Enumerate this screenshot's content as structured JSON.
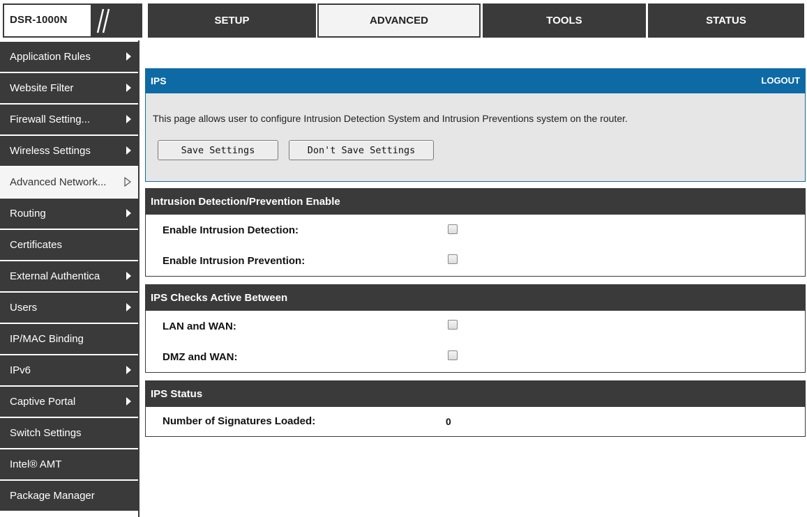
{
  "header": {
    "logo_text": "DSR-1000N",
    "tabs": [
      {
        "label": "SETUP"
      },
      {
        "label": "ADVANCED"
      },
      {
        "label": "TOOLS"
      },
      {
        "label": "STATUS"
      }
    ],
    "active_tab": "ADVANCED"
  },
  "sidebar": {
    "items": [
      {
        "label": "Application Rules",
        "has_submenu": true
      },
      {
        "label": "Website Filter",
        "has_submenu": true
      },
      {
        "label": "Firewall Setting...",
        "has_submenu": true
      },
      {
        "label": "Wireless Settings",
        "has_submenu": true
      },
      {
        "label": "Advanced Network...",
        "has_submenu": true,
        "active": true
      },
      {
        "label": "Routing",
        "has_submenu": true
      },
      {
        "label": "Certificates",
        "has_submenu": false
      },
      {
        "label": "External Authentica",
        "has_submenu": true
      },
      {
        "label": "Users",
        "has_submenu": true
      },
      {
        "label": "IP/MAC Binding",
        "has_submenu": false
      },
      {
        "label": "IPv6",
        "has_submenu": true
      },
      {
        "label": "Captive Portal",
        "has_submenu": true
      },
      {
        "label": "Switch Settings",
        "has_submenu": false
      },
      {
        "label": "Intel® AMT",
        "has_submenu": false
      },
      {
        "label": "Package Manager",
        "has_submenu": false
      }
    ]
  },
  "page": {
    "title": "IPS",
    "logout_label": "LOGOUT",
    "description": "This page allows user to configure Intrusion Detection System and Intrusion Preventions system on the router.",
    "save_button": "Save Settings",
    "dont_save_button": "Don't Save Settings"
  },
  "sections": {
    "enable": {
      "title": "Intrusion Detection/Prevention Enable",
      "detection_label": "Enable Intrusion Detection:",
      "detection_checked": false,
      "prevention_label": "Enable Intrusion Prevention:",
      "prevention_checked": false
    },
    "checks": {
      "title": "IPS Checks Active Between",
      "lan_wan_label": "LAN and WAN:",
      "lan_wan_checked": false,
      "dmz_wan_label": "DMZ and WAN:",
      "dmz_wan_checked": false
    },
    "status": {
      "title": "IPS Status",
      "signatures_label": "Number of Signatures Loaded:",
      "signatures_value": "0"
    }
  },
  "colors": {
    "nav_dark": "#3a3a3a",
    "header_blue": "#0e6aa5",
    "intro_bg": "#e6e6e6"
  },
  "icons": {
    "submenu_arrow": "triangle-right-icon",
    "active_submenu_arrow": "triangle-right-outline-icon",
    "logo_decoration": "slashes-icon"
  }
}
